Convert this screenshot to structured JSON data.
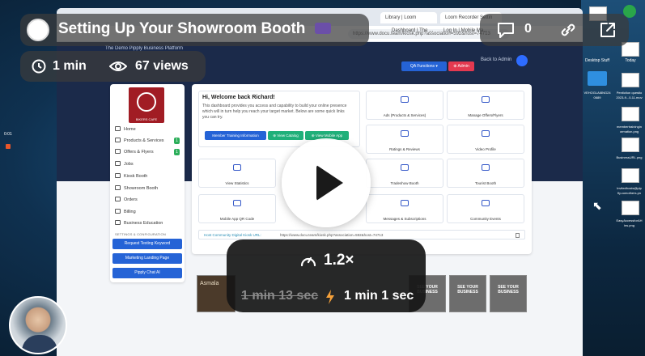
{
  "video": {
    "title": "Setting Up Your Showroom Booth",
    "duration": "1 min",
    "views": "67 views",
    "comment_count": "0",
    "speed": "1.2×",
    "original_duration": "1 min 13 sec",
    "adjusted_duration": "1 min 1 sec"
  },
  "icons": {
    "title_emoji": "movie-camera-icon",
    "clock": "clock-icon",
    "eye": "eye-icon",
    "comment": "comment-icon",
    "link": "link-icon",
    "external": "external-link-icon",
    "speed": "speedometer-icon",
    "bolt": "lightning-bolt-icon",
    "play": "play-icon"
  },
  "browser": {
    "tabs": [
      "Library | Loom",
      "Loom Recorder Settin"
    ],
    "bookmarks": [
      "Dashboard | The ...",
      "Log In | Mobile Ma..."
    ],
    "url": "https://www.docu.team/kiosk.php?association=592&host=74713"
  },
  "site": {
    "tagline": "The Demo Pipply Business Platform",
    "back_to_admin": "Back to Admin",
    "qa_button": "QA Functions ▾",
    "admin_button": "⊕ Admin",
    "logo_caption": "BIKERS CAFE",
    "sidebar": {
      "items": [
        {
          "label": "Home"
        },
        {
          "label": "Products & Services",
          "badge": "1"
        },
        {
          "label": "Offers & Flyers",
          "badge": "1"
        },
        {
          "label": "Jobs"
        },
        {
          "label": "Kiosk Booth"
        },
        {
          "label": "Showroom Booth"
        },
        {
          "label": "Orders"
        },
        {
          "label": "Billing"
        },
        {
          "label": "Business Education"
        }
      ],
      "section_title": "SETTINGS & CONFIGURATION",
      "buttons": [
        "Request Texting Keyword",
        "Marketing Landing Page",
        "Pipply Chat AI"
      ]
    },
    "welcome": {
      "title": "Hi, Welcome back Richard!",
      "text": "This dashboard provides you access and capability to build your online presence which will in turn help you reach your target market. Below are some quick links you can try.",
      "buttons": [
        "Member Training Information",
        "⊕ View Catalog",
        "⊕ View Mobile App"
      ]
    },
    "tiles": [
      "Ads (Products & Services)",
      "Manage Offers/Flyers",
      "Ratings & Reviews",
      "Video Profile",
      "View Statistics",
      "Tradeshow Booth",
      "Tourist Booth",
      "Mobile App QR Code",
      "Messages & Subscriptions",
      "Community Events"
    ],
    "kiosk_label": "Host Community Digital Kiosk URL:",
    "kiosk_url": "https://www.docu.team/kiosk.php?association=592&host=74713",
    "thumb_text": "Asmala",
    "see_your_business": "SEE YOUR BUSINESS"
  },
  "desktop": {
    "labels": [
      "Desktop Stuff",
      "Today",
      "VEHOGLAI8NG24 0689",
      "Pentiction questio 2023-9...0-11.mov",
      "membertrainingin ormation.png",
      "BusinessURL.png",
      "Invitedhosts@pip fly.comothers.pn",
      "EasyAccessforAH ins.png"
    ],
    "time": "0:01"
  }
}
